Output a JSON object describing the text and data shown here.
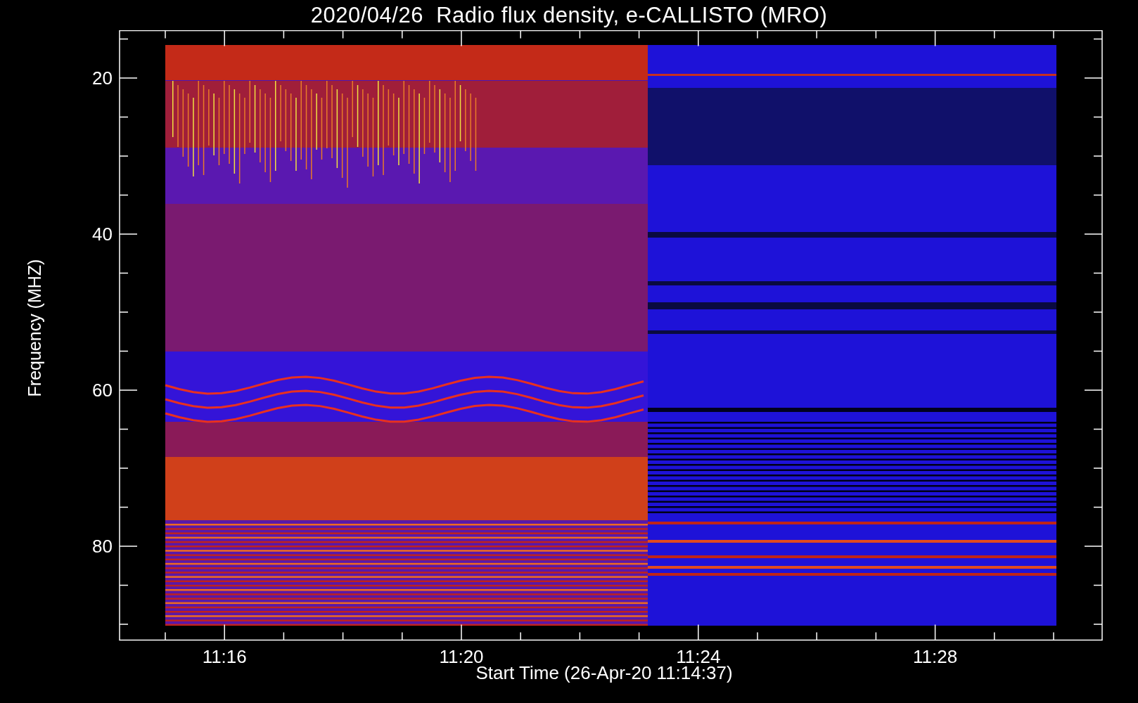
{
  "title": "2020/04/26  Radio flux density, e-CALLISTO (MRO)",
  "y_axis": {
    "label": "Frequency (MHZ)",
    "ticks": [
      "20",
      "40",
      "60",
      "80"
    ]
  },
  "x_axis": {
    "label": "Start Time (26-Apr-20 11:14:37)",
    "ticks": [
      "11:16",
      "11:20",
      "11:24",
      "11:28"
    ]
  }
}
